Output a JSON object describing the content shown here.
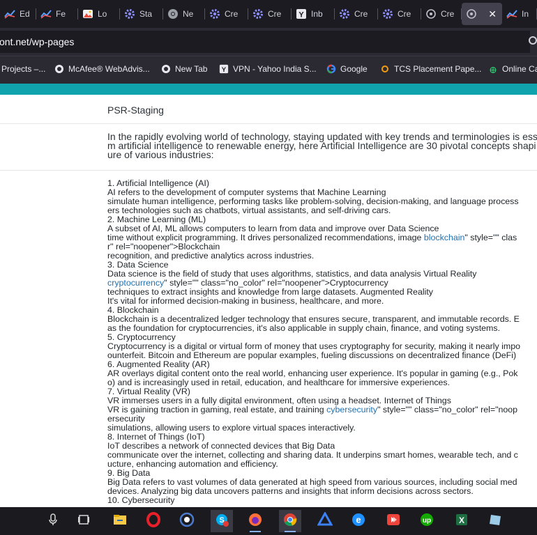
{
  "tabs": [
    {
      "label": "Ed",
      "icon": "chart-icon"
    },
    {
      "label": "Fe",
      "icon": "chart-icon"
    },
    {
      "label": "Lo",
      "icon": "image-icon"
    },
    {
      "label": "Sta",
      "icon": "gear-icon"
    },
    {
      "label": "Ne",
      "icon": "chrome-icon"
    },
    {
      "label": "Cre",
      "icon": "gear-icon"
    },
    {
      "label": "Cre",
      "icon": "gear-icon"
    },
    {
      "label": "Inb",
      "icon": "yahoo-icon"
    },
    {
      "label": "Cre",
      "icon": "gear-icon"
    },
    {
      "label": "Cre",
      "icon": "gear-icon"
    },
    {
      "label": "Cre",
      "icon": "page-icon"
    },
    {
      "label": "",
      "icon": "page-icon",
      "close": "✕"
    },
    {
      "label": "In",
      "icon": "chart-icon"
    }
  ],
  "url": "ont.net/wp-pages",
  "bookmarks": [
    {
      "label": "Projects –...",
      "icon": "folder-icon"
    },
    {
      "label": "McAfee® WebAdvis...",
      "icon": "globe-icon"
    },
    {
      "label": "New Tab",
      "icon": "globe-icon"
    },
    {
      "label": "VPN - Yahoo India S...",
      "icon": "yahoo-icon"
    },
    {
      "label": "Google",
      "icon": "google-icon"
    },
    {
      "label": "TCS Placement Pape...",
      "icon": "link-icon"
    },
    {
      "label": "Online Ca",
      "icon": "calc-icon"
    }
  ],
  "page": {
    "title": "PSR-Staging",
    "intro": [
      "In the rapidly evolving world of technology, staying updated with key trends and terminologies is ess",
      "m artificial intelligence to renewable energy, here Artificial Intelligence are 30 pivotal concepts shapi",
      "ure of various industries:"
    ],
    "lines": [
      [
        {
          "t": "1. Artificial Intelligence (AI)"
        }
      ],
      [
        {
          "t": "AI refers to the development of computer systems that Machine Learning"
        }
      ],
      [
        {
          "t": "simulate human intelligence, performing tasks like problem-solving, decision-making, and language process"
        }
      ],
      [
        {
          "t": "ers technologies such as chatbots, virtual assistants, and self-driving cars."
        }
      ],
      [
        {
          "t": "2. Machine Learning (ML)"
        }
      ],
      [
        {
          "t": "A subset of AI, ML allows computers to learn from data and improve over Data Science"
        }
      ],
      [
        {
          "t": "time without explicit programming. It drives personalized recommendations, image "
        },
        {
          "t": "blockchain",
          "link": true
        },
        {
          "t": "\" style=\"\" clas"
        }
      ],
      [
        {
          "t": "r\" rel=\"noopener\">Blockchain"
        }
      ],
      [
        {
          "t": "recognition, and predictive analytics across industries."
        }
      ],
      [
        {
          "t": "3. Data Science"
        }
      ],
      [
        {
          "t": "Data science is the field of study that uses algorithms, statistics, and data analysis Virtual Reality"
        }
      ],
      [
        {
          "t": "cryptocurrency",
          "link": true
        },
        {
          "t": "\" style=\"\" class=\"no_color\" rel=\"noopener\">Cryptocurrency"
        }
      ],
      [
        {
          "t": "techniques to extract insights and knowledge from large datasets. Augmented Reality"
        }
      ],
      [
        {
          "t": "It's vital for informed decision-making in business, healthcare, and more."
        }
      ],
      [
        {
          "t": "4. Blockchain"
        }
      ],
      [
        {
          "t": "Blockchain is a decentralized ledger technology that ensures secure, transparent, and immutable records. E"
        }
      ],
      [
        {
          "t": "as the foundation for cryptocurrencies, it's also applicable in supply chain, finance, and voting systems."
        }
      ],
      [
        {
          "t": "5. Cryptocurrency"
        }
      ],
      [
        {
          "t": "Cryptocurrency is a digital or virtual form of money that uses cryptography for security, making it nearly impo"
        }
      ],
      [
        {
          "t": "ounterfeit. Bitcoin and Ethereum are popular examples, fueling discussions on decentralized finance (DeFi)"
        }
      ],
      [
        {
          "t": "6. Augmented Reality (AR)"
        }
      ],
      [
        {
          "t": "AR overlays digital content onto the real world, enhancing user experience. It's popular in gaming (e.g., Pok"
        }
      ],
      [
        {
          "t": "o) and is increasingly used in retail, education, and healthcare for immersive experiences."
        }
      ],
      [
        {
          "t": "7. Virtual Reality (VR)"
        }
      ],
      [
        {
          "t": "VR immerses users in a fully digital environment, often using a headset. Internet of Things"
        }
      ],
      [
        {
          "t": "VR is gaining traction in gaming, real estate, and training "
        },
        {
          "t": "cybersecurity",
          "link": true
        },
        {
          "t": "\" style=\"\" class=\"no_color\" rel=\"noop"
        }
      ],
      [
        {
          "t": "ersecurity"
        }
      ],
      [
        {
          "t": "simulations, allowing users to explore virtual spaces interactively."
        }
      ],
      [
        {
          "t": "8. Internet of Things (IoT)"
        }
      ],
      [
        {
          "t": "IoT describes a network of connected devices that Big Data"
        }
      ],
      [
        {
          "t": "communicate over the internet, collecting and sharing data. It underpins smart homes, wearable tech, and c"
        }
      ],
      [
        {
          "t": "ucture, enhancing automation and efficiency."
        }
      ],
      [
        {
          "t": "9. Big Data"
        }
      ],
      [
        {
          "t": "Big Data refers to vast volumes of data generated at high speed from various sources, including social med"
        }
      ],
      [
        {
          "t": "devices. Analyzing big data uncovers patterns and insights that inform decisions across sectors."
        }
      ],
      [
        {
          "t": "10. Cybersecurity"
        }
      ]
    ]
  },
  "taskbar": [
    {
      "icon": "microphone-icon"
    },
    {
      "icon": "task-view-icon"
    },
    {
      "icon": "file-explorer-icon"
    },
    {
      "icon": "opera-icon"
    },
    {
      "icon": "app-circle-icon"
    },
    {
      "icon": "skype-icon"
    },
    {
      "icon": "firefox-icon"
    },
    {
      "icon": "chrome-icon"
    },
    {
      "icon": "azure-icon"
    },
    {
      "icon": "edge-icon"
    },
    {
      "icon": "anydesk-icon"
    },
    {
      "icon": "upwork-icon"
    },
    {
      "icon": "excel-icon"
    },
    {
      "icon": "notes-icon"
    }
  ],
  "colors": {
    "teal_bar": "#11a3ad",
    "link": "#2271b1",
    "tab_bg": "#1c1b22",
    "toolbar_bg": "#2b2a33"
  }
}
